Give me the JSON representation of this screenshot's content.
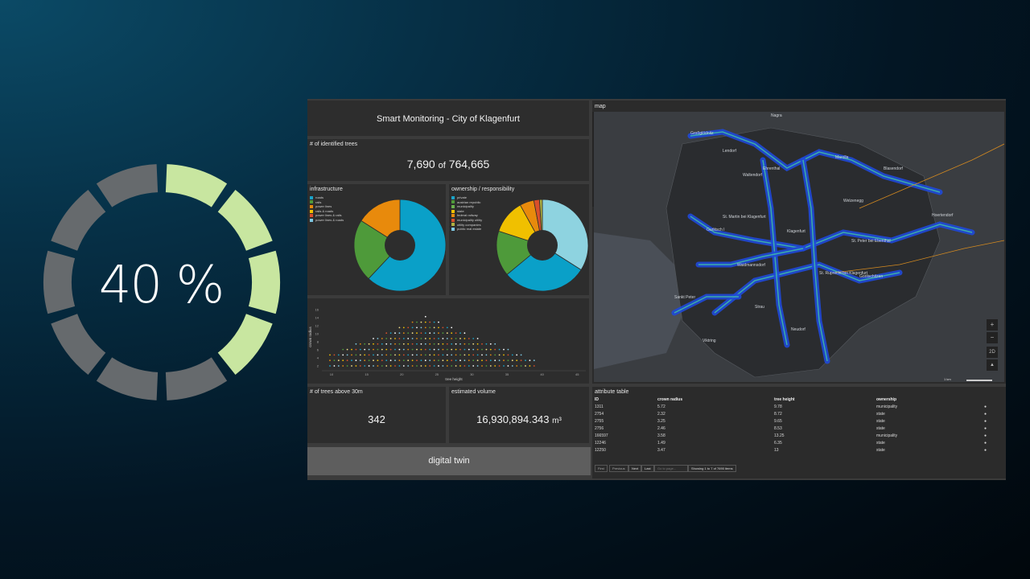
{
  "progress": {
    "percent_label": "40 %",
    "value": 0.4,
    "segments": 10,
    "filled_color": "#c8e6a0",
    "empty_color": "#666a6d"
  },
  "header": {
    "title": "Smart Monitoring - City of Klagenfurt"
  },
  "identified": {
    "title": "# of identified trees",
    "count": "7,690",
    "of_label": "of",
    "total": "764,665"
  },
  "infrastructure": {
    "title": "infrastructure",
    "legend": [
      {
        "label": "roads",
        "color": "#1aa3c8"
      },
      {
        "label": "rails",
        "color": "#4e9a3a"
      },
      {
        "label": "power lines",
        "color": "#e48a0e"
      },
      {
        "label": "rails & roads",
        "color": "#f0c000"
      },
      {
        "label": "power lines & rails",
        "color": "#d94f2a"
      },
      {
        "label": "power lines & roads",
        "color": "#7ec8e3"
      }
    ],
    "pie": [
      {
        "value": 62,
        "color": "#0aa0c8"
      },
      {
        "value": 22,
        "color": "#4e9a3a"
      },
      {
        "value": 16,
        "color": "#e88a0c"
      }
    ]
  },
  "ownership": {
    "title": "ownership / responsibility",
    "legend": [
      {
        "label": "private",
        "color": "#1aa3c8"
      },
      {
        "label": "austrian republic",
        "color": "#4e9a3a"
      },
      {
        "label": "municipality",
        "color": "#6ab04c"
      },
      {
        "label": "state",
        "color": "#f0c000"
      },
      {
        "label": "federal railway",
        "color": "#e48a0e"
      },
      {
        "label": "municipality utility",
        "color": "#d94f2a"
      },
      {
        "label": "utility companies",
        "color": "#b0b040"
      },
      {
        "label": "public real estate",
        "color": "#7ec8e3"
      }
    ],
    "pie": [
      {
        "value": 34,
        "color": "#8ed3e0"
      },
      {
        "value": 30,
        "color": "#0aa0c8"
      },
      {
        "value": 16,
        "color": "#4e9a3a"
      },
      {
        "value": 12,
        "color": "#f0c000"
      },
      {
        "value": 5,
        "color": "#e88a0c"
      },
      {
        "value": 2,
        "color": "#d94f2a"
      },
      {
        "value": 1,
        "color": "#b0b040"
      }
    ]
  },
  "scatter": {
    "xlabel": "tree height",
    "ylabel": "crown radius",
    "xticks": [
      "10",
      "15",
      "20",
      "25",
      "30",
      "35",
      "40",
      "45",
      "50"
    ],
    "yticks": [
      "2",
      "4",
      "6",
      "8",
      "10",
      "12",
      "14",
      "16"
    ]
  },
  "above30": {
    "title": "# of trees above 30m",
    "value": "342"
  },
  "volume": {
    "title": "estimated volume",
    "value": "16,930,894.343",
    "unit": "m³"
  },
  "twin": {
    "label": "digital twin"
  },
  "map": {
    "title": "map",
    "places": [
      {
        "label": "Großglödnitz"
      },
      {
        "label": "Nagra"
      },
      {
        "label": "Lendorf"
      },
      {
        "label": "Marolla"
      },
      {
        "label": "Ehrenthal"
      },
      {
        "label": "Waltendorf"
      },
      {
        "label": "Blasendorf"
      },
      {
        "label": "Welzenegg"
      },
      {
        "label": "Hoertendorf"
      },
      {
        "label": "St. Martin bei Klagenfurt"
      },
      {
        "label": "Klagenfurt"
      },
      {
        "label": "St. Peter bei Ebenthal"
      },
      {
        "label": "Waidmannsdorf"
      },
      {
        "label": "St. Ruprecht bei Klagenfurt"
      },
      {
        "label": "Gurlitsch I"
      },
      {
        "label": "Sankt Peter"
      },
      {
        "label": "Strau"
      },
      {
        "label": "Neudorf"
      },
      {
        "label": "Viktring"
      },
      {
        "label": "Goritschitzen"
      }
    ],
    "zoom_in": "+",
    "zoom_out": "−",
    "mode": "2D",
    "north": "▲",
    "scale": "1 km"
  },
  "attr_table": {
    "title": "attribute table",
    "columns": [
      "ID",
      "crown radius",
      "tree height",
      "ownership"
    ],
    "rows": [
      [
        "1311",
        "5.72",
        "9.78",
        "municipality"
      ],
      [
        "2754",
        "2.32",
        "8.72",
        "state"
      ],
      [
        "2755",
        "3.25",
        "9.65",
        "state"
      ],
      [
        "2756",
        "2.46",
        "8.53",
        "state"
      ],
      [
        "166597",
        "3.58",
        "13.25",
        "municipality"
      ],
      [
        "12246",
        "1.49",
        "6.35",
        "state"
      ],
      [
        "12250",
        "3.47",
        "13",
        "state"
      ]
    ],
    "pager": {
      "first": "First",
      "previous": "Previous",
      "next": "Next",
      "last": "Last",
      "goto_placeholder": "Go to page...",
      "status": "Showing 1 to 7 of 7690 items"
    }
  }
}
